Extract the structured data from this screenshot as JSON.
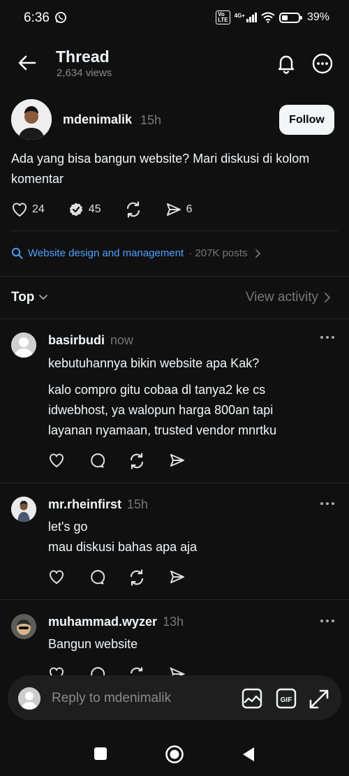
{
  "status": {
    "time": "6:36",
    "network": "4G+",
    "battery": "39%"
  },
  "header": {
    "title": "Thread",
    "views": "2,634 views"
  },
  "post": {
    "author": "mdenimalik",
    "time": "15h",
    "follow_label": "Follow",
    "text": "Ada yang bisa bangun website? Mari diskusi di kolom komentar",
    "likes": "24",
    "comments": "45",
    "shares": "6"
  },
  "topic": {
    "name": "Website design and management",
    "count": "· 207K posts"
  },
  "sort": {
    "label": "Top",
    "view_activity": "View activity"
  },
  "comments": [
    {
      "name": "basirbudi",
      "time": "now",
      "text1": "kebutuhannya bikin website apa Kak?",
      "text2": "kalo compro gitu cobaa dl tanya2 ke cs idwebhost, ya walopun harga 800an tapi layanan nyamaan, trusted vendor mnrtku"
    },
    {
      "name": "mr.rheinfirst",
      "time": "15h",
      "text1": "let's go",
      "text2": "mau diskusi bahas apa aja"
    },
    {
      "name": "muhammad.wyzer",
      "time": "13h",
      "text1": "Bangun website"
    }
  ],
  "reply": {
    "placeholder": "Reply to mdenimalik",
    "gif_label": "GIF"
  },
  "colors": {
    "background": "#101010",
    "link": "#4ea0ff",
    "muted": "#777777",
    "verified": "#e0e0e0"
  }
}
